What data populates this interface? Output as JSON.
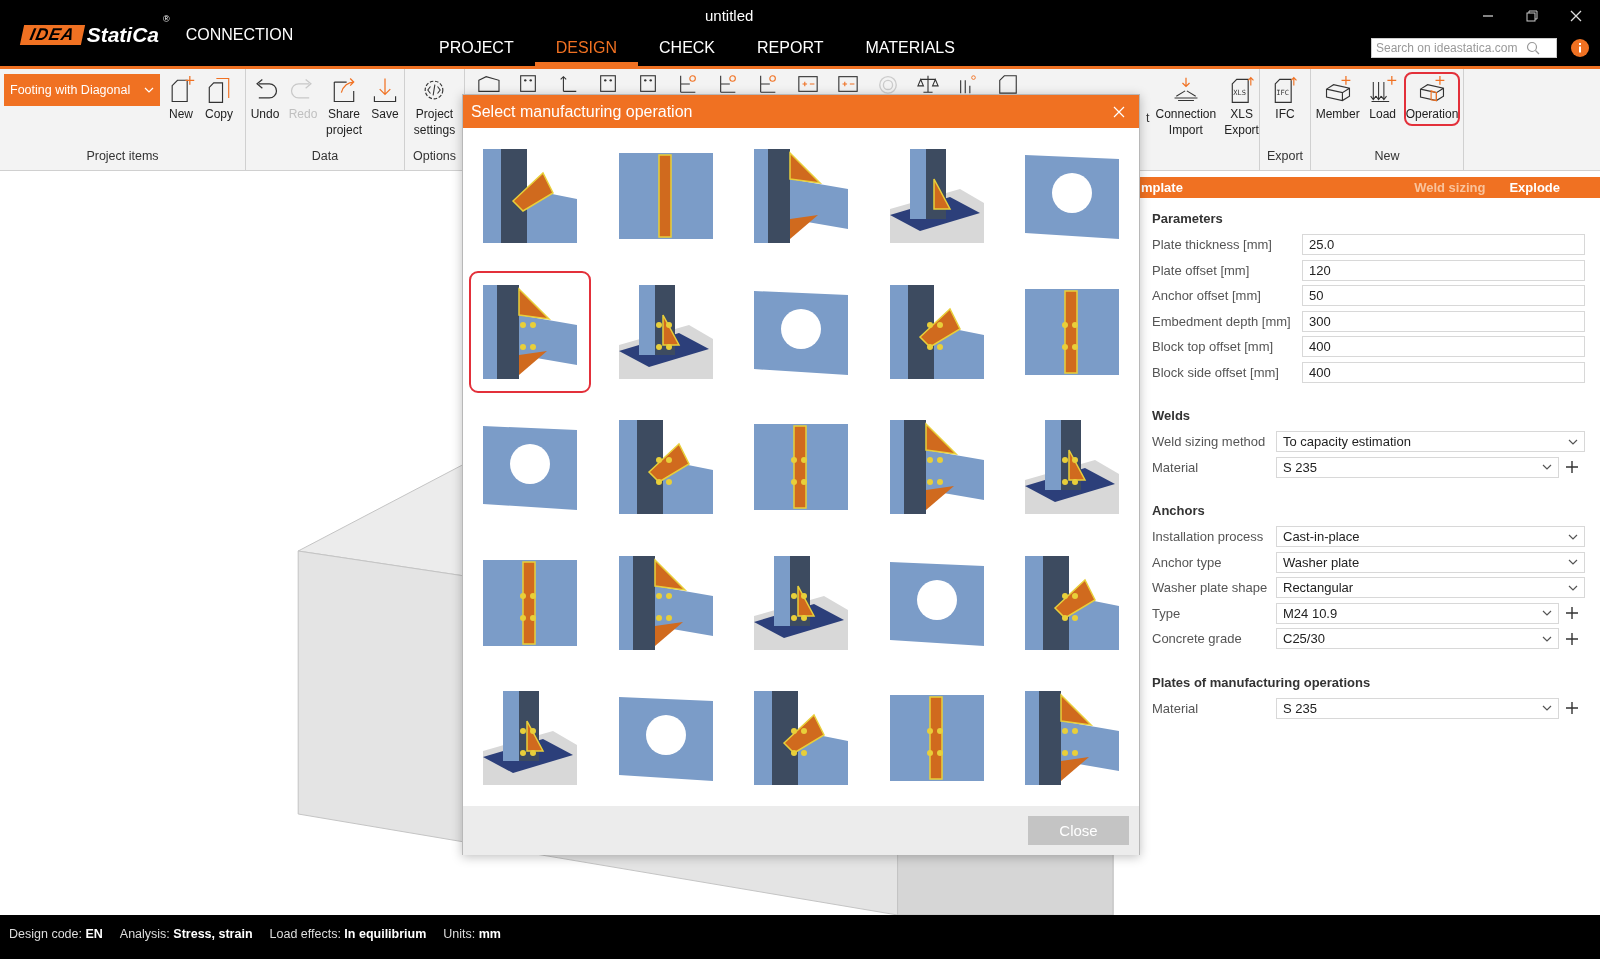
{
  "window": {
    "title": "untitled"
  },
  "logo": {
    "mark": "IDEA",
    "name": "StatiCa",
    "registered": "®",
    "product": "CONNECTION"
  },
  "tabs": [
    {
      "label": "PROJECT",
      "selected": false
    },
    {
      "label": "DESIGN",
      "selected": true
    },
    {
      "label": "CHECK",
      "selected": false
    },
    {
      "label": "REPORT",
      "selected": false
    },
    {
      "label": "MATERIALS",
      "selected": false
    }
  ],
  "search": {
    "placeholder": "Search on ideastatica.com"
  },
  "ribbon": {
    "project_dropdown": "Footing with Diagonal",
    "groups": [
      {
        "label": "Project items",
        "buttons": [
          {
            "label": "New",
            "disabled": false,
            "highlighted": false
          },
          {
            "label": "Copy",
            "disabled": false,
            "highlighted": false
          }
        ]
      },
      {
        "label": "Data",
        "buttons": [
          {
            "label": "Undo",
            "disabled": false,
            "highlighted": false
          },
          {
            "label": "Redo",
            "disabled": true,
            "highlighted": false
          },
          {
            "label": "Share project",
            "disabled": false,
            "highlighted": false
          },
          {
            "label": "Save",
            "disabled": false,
            "highlighted": false
          }
        ]
      },
      {
        "label": "Options",
        "buttons": [
          {
            "label": "Project settings",
            "disabled": false,
            "highlighted": false
          }
        ]
      },
      {
        "cut_label": "t",
        "buttons": [
          {
            "label": "Connection Import",
            "disabled": false,
            "highlighted": false
          },
          {
            "label": "XLS Export",
            "icon_text": "XLS",
            "disabled": false,
            "highlighted": false
          }
        ]
      },
      {
        "label": "Export",
        "buttons": [
          {
            "label": "IFC",
            "icon_text": "IFC",
            "disabled": false,
            "highlighted": false
          }
        ]
      },
      {
        "label": "New",
        "buttons": [
          {
            "label": "Member",
            "disabled": false,
            "highlighted": false
          },
          {
            "label": "Load",
            "disabled": false,
            "highlighted": false
          },
          {
            "label": "Operation",
            "disabled": false,
            "highlighted": true
          }
        ]
      }
    ]
  },
  "dialog": {
    "title": "Select manufacturing operation",
    "close_button": "Close",
    "tiles": [
      {
        "selected": false
      },
      {
        "selected": false
      },
      {
        "selected": false
      },
      {
        "selected": false
      },
      {
        "selected": false
      },
      {
        "selected": true
      },
      {
        "selected": false
      },
      {
        "selected": false
      },
      {
        "selected": false
      },
      {
        "selected": false
      },
      {
        "selected": false
      },
      {
        "selected": false
      },
      {
        "selected": false
      },
      {
        "selected": false
      },
      {
        "selected": false
      },
      {
        "selected": false
      },
      {
        "selected": false
      },
      {
        "selected": false
      },
      {
        "selected": false
      },
      {
        "selected": false
      },
      {
        "selected": false
      },
      {
        "selected": false
      },
      {
        "selected": false
      },
      {
        "selected": false
      },
      {
        "selected": false
      }
    ]
  },
  "panel": {
    "header": {
      "title": "mplate",
      "actions": [
        {
          "label": "Weld sizing",
          "disabled": true
        },
        {
          "label": "Explode",
          "disabled": false
        }
      ]
    },
    "sections": [
      {
        "title": "Parameters",
        "fields": [
          {
            "label": "Plate thickness [mm]",
            "kind": "input",
            "value": "25.0",
            "addable": false
          },
          {
            "label": "Plate offset [mm]",
            "kind": "input",
            "value": "120",
            "addable": false
          },
          {
            "label": "Anchor offset [mm]",
            "kind": "input",
            "value": "50",
            "addable": false
          },
          {
            "label": "Embedment depth [mm]",
            "kind": "input",
            "value": "300",
            "addable": false
          },
          {
            "label": "Block top offset [mm]",
            "kind": "input",
            "value": "400",
            "addable": false
          },
          {
            "label": "Block side offset [mm]",
            "kind": "input",
            "value": "400",
            "addable": false
          }
        ]
      },
      {
        "title": "Welds",
        "fields": [
          {
            "label": "Weld sizing method",
            "kind": "select",
            "value": "To capacity estimation",
            "addable": false
          },
          {
            "label": "Material",
            "kind": "select",
            "value": "S 235",
            "addable": true
          }
        ]
      },
      {
        "title": "Anchors",
        "fields": [
          {
            "label": "Installation process",
            "kind": "select",
            "value": "Cast-in-place",
            "addable": false
          },
          {
            "label": "Anchor type",
            "kind": "select",
            "value": "Washer plate",
            "addable": false
          },
          {
            "label": "Washer plate shape",
            "kind": "select",
            "value": "Rectangular",
            "addable": false
          },
          {
            "label": "Type",
            "kind": "select",
            "value": "M24 10.9",
            "addable": true
          },
          {
            "label": "Concrete grade",
            "kind": "select",
            "value": "C25/30",
            "addable": true
          }
        ]
      },
      {
        "title": "Plates of manufacturing operations",
        "fields": [
          {
            "label": "Material",
            "kind": "select",
            "value": "S 235",
            "addable": true
          }
        ]
      }
    ]
  },
  "status_bar": [
    "Design code: **EN**",
    "Analysis: **Stress, strain**",
    "Load effects: **In equilibrium**",
    "Units: **mm**"
  ]
}
